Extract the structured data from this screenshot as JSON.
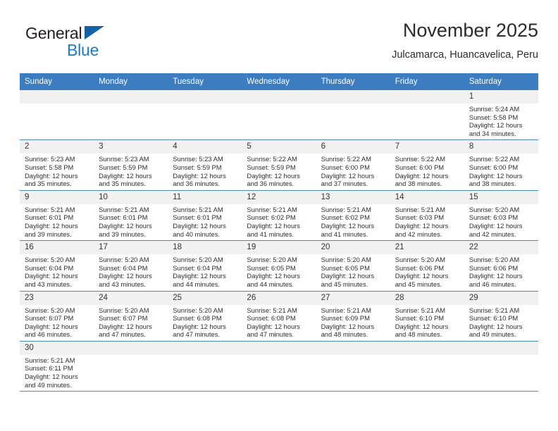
{
  "brand": {
    "name_top": "General",
    "name_bottom": "Blue",
    "accent_color": "#1d7cc4",
    "triangle_color": "#1461a8"
  },
  "header": {
    "title": "November 2025",
    "subtitle": "Julcamarca, Huancavelica, Peru"
  },
  "calendar": {
    "header_bg": "#3b7dc0",
    "header_text_color": "#ffffff",
    "row_divider_color": "#4a89c6",
    "daynum_bg": "#f1f1f1",
    "weekdays": [
      "Sunday",
      "Monday",
      "Tuesday",
      "Wednesday",
      "Thursday",
      "Friday",
      "Saturday"
    ],
    "weeks": [
      [
        {
          "day": "",
          "empty": true,
          "lines": []
        },
        {
          "day": "",
          "empty": true,
          "lines": []
        },
        {
          "day": "",
          "empty": true,
          "lines": []
        },
        {
          "day": "",
          "empty": true,
          "lines": []
        },
        {
          "day": "",
          "empty": true,
          "lines": []
        },
        {
          "day": "",
          "empty": true,
          "lines": []
        },
        {
          "day": "1",
          "empty": false,
          "lines": [
            "Sunrise: 5:24 AM",
            "Sunset: 5:58 PM",
            "Daylight: 12 hours",
            "and 34 minutes."
          ]
        }
      ],
      [
        {
          "day": "2",
          "empty": false,
          "lines": [
            "Sunrise: 5:23 AM",
            "Sunset: 5:58 PM",
            "Daylight: 12 hours",
            "and 35 minutes."
          ]
        },
        {
          "day": "3",
          "empty": false,
          "lines": [
            "Sunrise: 5:23 AM",
            "Sunset: 5:59 PM",
            "Daylight: 12 hours",
            "and 35 minutes."
          ]
        },
        {
          "day": "4",
          "empty": false,
          "lines": [
            "Sunrise: 5:23 AM",
            "Sunset: 5:59 PM",
            "Daylight: 12 hours",
            "and 36 minutes."
          ]
        },
        {
          "day": "5",
          "empty": false,
          "lines": [
            "Sunrise: 5:22 AM",
            "Sunset: 5:59 PM",
            "Daylight: 12 hours",
            "and 36 minutes."
          ]
        },
        {
          "day": "6",
          "empty": false,
          "lines": [
            "Sunrise: 5:22 AM",
            "Sunset: 6:00 PM",
            "Daylight: 12 hours",
            "and 37 minutes."
          ]
        },
        {
          "day": "7",
          "empty": false,
          "lines": [
            "Sunrise: 5:22 AM",
            "Sunset: 6:00 PM",
            "Daylight: 12 hours",
            "and 38 minutes."
          ]
        },
        {
          "day": "8",
          "empty": false,
          "lines": [
            "Sunrise: 5:22 AM",
            "Sunset: 6:00 PM",
            "Daylight: 12 hours",
            "and 38 minutes."
          ]
        }
      ],
      [
        {
          "day": "9",
          "empty": false,
          "lines": [
            "Sunrise: 5:21 AM",
            "Sunset: 6:01 PM",
            "Daylight: 12 hours",
            "and 39 minutes."
          ]
        },
        {
          "day": "10",
          "empty": false,
          "lines": [
            "Sunrise: 5:21 AM",
            "Sunset: 6:01 PM",
            "Daylight: 12 hours",
            "and 39 minutes."
          ]
        },
        {
          "day": "11",
          "empty": false,
          "lines": [
            "Sunrise: 5:21 AM",
            "Sunset: 6:01 PM",
            "Daylight: 12 hours",
            "and 40 minutes."
          ]
        },
        {
          "day": "12",
          "empty": false,
          "lines": [
            "Sunrise: 5:21 AM",
            "Sunset: 6:02 PM",
            "Daylight: 12 hours",
            "and 41 minutes."
          ]
        },
        {
          "day": "13",
          "empty": false,
          "lines": [
            "Sunrise: 5:21 AM",
            "Sunset: 6:02 PM",
            "Daylight: 12 hours",
            "and 41 minutes."
          ]
        },
        {
          "day": "14",
          "empty": false,
          "lines": [
            "Sunrise: 5:21 AM",
            "Sunset: 6:03 PM",
            "Daylight: 12 hours",
            "and 42 minutes."
          ]
        },
        {
          "day": "15",
          "empty": false,
          "lines": [
            "Sunrise: 5:20 AM",
            "Sunset: 6:03 PM",
            "Daylight: 12 hours",
            "and 42 minutes."
          ]
        }
      ],
      [
        {
          "day": "16",
          "empty": false,
          "lines": [
            "Sunrise: 5:20 AM",
            "Sunset: 6:04 PM",
            "Daylight: 12 hours",
            "and 43 minutes."
          ]
        },
        {
          "day": "17",
          "empty": false,
          "lines": [
            "Sunrise: 5:20 AM",
            "Sunset: 6:04 PM",
            "Daylight: 12 hours",
            "and 43 minutes."
          ]
        },
        {
          "day": "18",
          "empty": false,
          "lines": [
            "Sunrise: 5:20 AM",
            "Sunset: 6:04 PM",
            "Daylight: 12 hours",
            "and 44 minutes."
          ]
        },
        {
          "day": "19",
          "empty": false,
          "lines": [
            "Sunrise: 5:20 AM",
            "Sunset: 6:05 PM",
            "Daylight: 12 hours",
            "and 44 minutes."
          ]
        },
        {
          "day": "20",
          "empty": false,
          "lines": [
            "Sunrise: 5:20 AM",
            "Sunset: 6:05 PM",
            "Daylight: 12 hours",
            "and 45 minutes."
          ]
        },
        {
          "day": "21",
          "empty": false,
          "lines": [
            "Sunrise: 5:20 AM",
            "Sunset: 6:06 PM",
            "Daylight: 12 hours",
            "and 45 minutes."
          ]
        },
        {
          "day": "22",
          "empty": false,
          "lines": [
            "Sunrise: 5:20 AM",
            "Sunset: 6:06 PM",
            "Daylight: 12 hours",
            "and 46 minutes."
          ]
        }
      ],
      [
        {
          "day": "23",
          "empty": false,
          "lines": [
            "Sunrise: 5:20 AM",
            "Sunset: 6:07 PM",
            "Daylight: 12 hours",
            "and 46 minutes."
          ]
        },
        {
          "day": "24",
          "empty": false,
          "lines": [
            "Sunrise: 5:20 AM",
            "Sunset: 6:07 PM",
            "Daylight: 12 hours",
            "and 47 minutes."
          ]
        },
        {
          "day": "25",
          "empty": false,
          "lines": [
            "Sunrise: 5:20 AM",
            "Sunset: 6:08 PM",
            "Daylight: 12 hours",
            "and 47 minutes."
          ]
        },
        {
          "day": "26",
          "empty": false,
          "lines": [
            "Sunrise: 5:21 AM",
            "Sunset: 6:08 PM",
            "Daylight: 12 hours",
            "and 47 minutes."
          ]
        },
        {
          "day": "27",
          "empty": false,
          "lines": [
            "Sunrise: 5:21 AM",
            "Sunset: 6:09 PM",
            "Daylight: 12 hours",
            "and 48 minutes."
          ]
        },
        {
          "day": "28",
          "empty": false,
          "lines": [
            "Sunrise: 5:21 AM",
            "Sunset: 6:10 PM",
            "Daylight: 12 hours",
            "and 48 minutes."
          ]
        },
        {
          "day": "29",
          "empty": false,
          "lines": [
            "Sunrise: 5:21 AM",
            "Sunset: 6:10 PM",
            "Daylight: 12 hours",
            "and 49 minutes."
          ]
        }
      ],
      [
        {
          "day": "30",
          "empty": false,
          "lines": [
            "Sunrise: 5:21 AM",
            "Sunset: 6:11 PM",
            "Daylight: 12 hours",
            "and 49 minutes."
          ]
        },
        {
          "day": "",
          "empty": true,
          "lines": []
        },
        {
          "day": "",
          "empty": true,
          "lines": []
        },
        {
          "day": "",
          "empty": true,
          "lines": []
        },
        {
          "day": "",
          "empty": true,
          "lines": []
        },
        {
          "day": "",
          "empty": true,
          "lines": []
        },
        {
          "day": "",
          "empty": true,
          "lines": []
        }
      ]
    ]
  }
}
